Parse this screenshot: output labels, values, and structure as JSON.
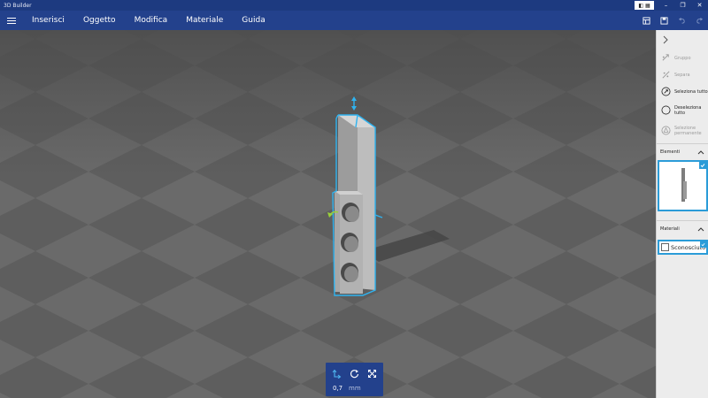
{
  "window": {
    "title": "3D Builder"
  },
  "menu": {
    "items": [
      {
        "label": "Inserisci"
      },
      {
        "label": "Oggetto"
      },
      {
        "label": "Modifica"
      },
      {
        "label": "Materiale"
      },
      {
        "label": "Guida"
      }
    ]
  },
  "panel": {
    "actions": [
      {
        "label": "Gruppo",
        "enabled": false,
        "icon": "group-icon"
      },
      {
        "label": "Separa",
        "enabled": false,
        "icon": "separate-icon"
      },
      {
        "label": "Seleziona tutto",
        "enabled": true,
        "icon": "select-all-icon"
      },
      {
        "label": "Deseleziona tutto",
        "enabled": true,
        "icon": "deselect-all-icon"
      },
      {
        "label": "Selezione permanente",
        "enabled": false,
        "icon": "permanent-selection-icon"
      }
    ],
    "elements_header": "Elementi",
    "materials_header": "Materiali",
    "material_name": "Sconosciuto"
  },
  "transform": {
    "value": "0,7",
    "unit": "mm",
    "modes": [
      "move-icon",
      "rotate-icon",
      "scale-icon"
    ]
  },
  "colors": {
    "titlebar": "#1d3a80",
    "menubar": "#23418c",
    "accent": "#2b9cd8",
    "floor_light": "#666666",
    "floor_dark": "#575757"
  }
}
